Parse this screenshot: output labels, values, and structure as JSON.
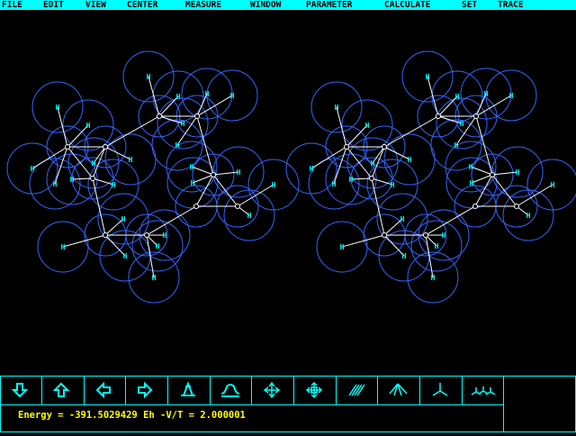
{
  "colors": {
    "menubar_bg": "#00ffff",
    "menu_text": "#000000",
    "background": "#000000",
    "atom_sphere": "#3366ff",
    "bond": "#ffffff",
    "hydrogen_label": "#00ffff",
    "panel_lines": "#00ffff",
    "status_text": "#ffff00"
  },
  "menu": {
    "items": [
      {
        "label": "FILE"
      },
      {
        "label": "EDIT"
      },
      {
        "label": "VIEW"
      },
      {
        "label": "CENTER"
      },
      {
        "label": "MEASURE"
      },
      {
        "label": "WINDOW"
      },
      {
        "label": "PARAMETER"
      },
      {
        "label": "CALCULATE"
      },
      {
        "label": "SET"
      },
      {
        "label": "TRACE"
      }
    ]
  },
  "viewport": {
    "mode": "stereo",
    "atom_label": "H"
  },
  "toolbar": {
    "buttons": [
      {
        "name": "rotate-down-button",
        "icon": "arrow-down-icon"
      },
      {
        "name": "rotate-up-button",
        "icon": "arrow-up-icon"
      },
      {
        "name": "rotate-left-button",
        "icon": "arrow-left-icon"
      },
      {
        "name": "rotate-right-button",
        "icon": "arrow-right-icon"
      },
      {
        "name": "rotate-z-ccw-button",
        "icon": "z-rotate-ccw-icon"
      },
      {
        "name": "rotate-z-cw-button",
        "icon": "z-rotate-cw-icon"
      },
      {
        "name": "translate-button",
        "icon": "move-arrows-icon"
      },
      {
        "name": "zoom-button",
        "icon": "zoom-arrows-icon"
      },
      {
        "name": "stripe-render-button",
        "icon": "diagonal-stripes-icon"
      },
      {
        "name": "sticks-render-button",
        "icon": "sticks-icon"
      },
      {
        "name": "tripod-render-button",
        "icon": "tripod-icon"
      },
      {
        "name": "multi-tripod-button",
        "icon": "multi-tripod-icon"
      }
    ]
  },
  "status": {
    "energy_text": "Energy = -391.5029429 Eh -V/T = 2.000001"
  }
}
